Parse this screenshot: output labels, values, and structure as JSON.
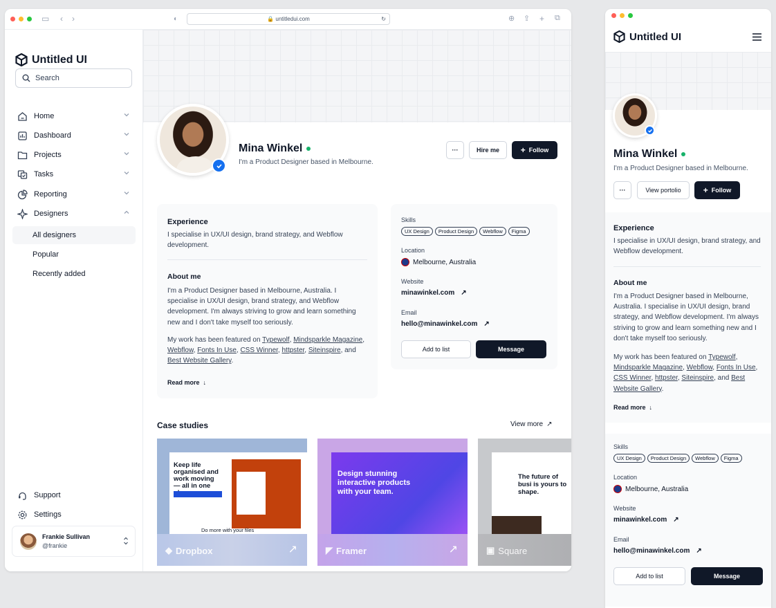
{
  "browser": {
    "url": "untitledui.com"
  },
  "app": {
    "logo_text": "Untitled UI"
  },
  "search": {
    "placeholder": "Search"
  },
  "nav": [
    {
      "label": "Home",
      "icon": "home-icon"
    },
    {
      "label": "Dashboard",
      "icon": "dashboard-icon"
    },
    {
      "label": "Projects",
      "icon": "folder-icon"
    },
    {
      "label": "Tasks",
      "icon": "tasks-icon"
    },
    {
      "label": "Reporting",
      "icon": "pie-chart-icon"
    },
    {
      "label": "Designers",
      "icon": "sparkle-icon"
    }
  ],
  "subnav": [
    "All designers",
    "Popular",
    "Recently added"
  ],
  "footer_nav": [
    "Support",
    "Settings"
  ],
  "user": {
    "name": "Frankie Sullivan",
    "handle": "@frankie"
  },
  "profile": {
    "name": "Mina Winkel",
    "tagline": "I'm a Product Designer based in Melbourne.",
    "hire": "Hire me",
    "follow": "Follow",
    "view_portfolio": "View portolio",
    "more": "···"
  },
  "experience": {
    "title": "Experience",
    "text": "I specialise in UX/UI design, brand strategy, and Webflow development."
  },
  "about": {
    "title": "About me",
    "text": "I'm a Product Designer based in Melbourne, Australia. I specialise in UX/UI design, brand strategy, and Webflow development. I'm always striving to grow and learn something new and I don't take myself too seriously.",
    "featured_prefix": "My work has been featured on ",
    "links": [
      "Typewolf",
      "Mindsparkle Magazine",
      "Webflow",
      "Fonts In Use",
      "CSS Winner",
      "httpster",
      "Siteinspire",
      "Best Website Gallery"
    ],
    "and": "and",
    "readmore": "Read more"
  },
  "details": {
    "skills_label": "Skills",
    "skills": [
      "UX Design",
      "Product Design",
      "Webflow",
      "Figma"
    ],
    "location_label": "Location",
    "location": "Melbourne, Australia",
    "website_label": "Website",
    "website": "minawinkel.com",
    "email_label": "Email",
    "email": "hello@minawinkel.com",
    "add": "Add to list",
    "message": "Message"
  },
  "cases": {
    "title": "Case studies",
    "view_more": "View more",
    "items": [
      {
        "brand": "Dropbox",
        "headline": "Keep life organised and work moving — all in one place",
        "caption": "Do more with your files"
      },
      {
        "brand": "Framer",
        "headline": "Design stunning interactive products with your team."
      },
      {
        "brand": "Square",
        "headline": "The future of busi is yours to shape."
      }
    ]
  }
}
